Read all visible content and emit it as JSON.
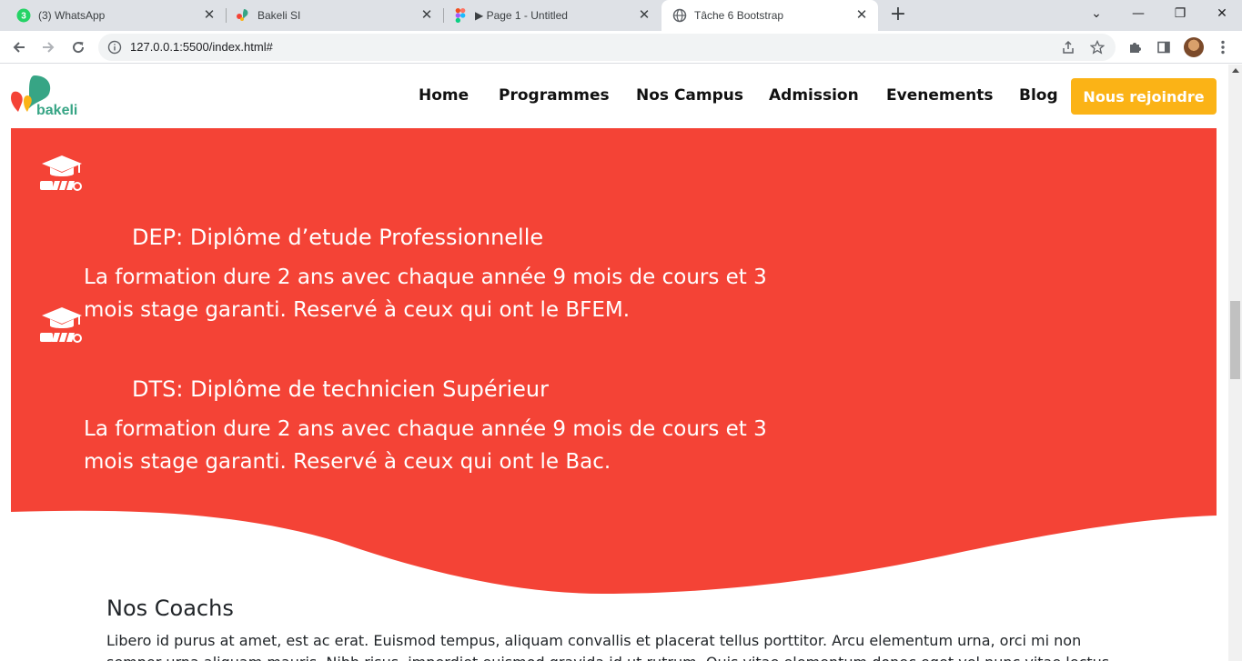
{
  "browser": {
    "tabs": [
      {
        "title": "(3) WhatsApp",
        "badge": "3"
      },
      {
        "title": "Bakeli SI"
      },
      {
        "title": "▶ Page 1 - Untitled"
      },
      {
        "title": "Tâche 6 Bootstrap"
      }
    ],
    "url": "127.0.0.1:5500/index.html#"
  },
  "site": {
    "logo_text": "bakeli",
    "nav": [
      "Home",
      "Programmes",
      "Nos Campus",
      "Admission",
      "Evenements",
      "Blog"
    ],
    "cta_label": "Nous rejoindre",
    "colors": {
      "accent_red": "#f44336",
      "cta_yellow": "#fbb316",
      "logo_green": "#37a585"
    }
  },
  "programs": [
    {
      "title": "DEP: Diplôme d’etude Professionnelle",
      "desc": "La formation dure 2 ans avec chaque année 9 mois de cours et 3 mois stage garanti. Reservé à ceux qui ont le BFEM."
    },
    {
      "title": "DTS: Diplôme de technicien Supérieur",
      "desc": "La formation dure 2 ans avec chaque année 9 mois de cours et 3 mois stage garanti. Reservé à ceux qui ont le Bac."
    }
  ],
  "coachs": {
    "title": "Nos Coachs",
    "text": "Libero id purus at amet, est ac erat. Euismod tempus, aliquam convallis et placerat tellus porttitor. Arcu elementum urna, orci mi non semper urna aliquam mauris. Nibh risus, imperdiet euismod gravida id ut rutrum. Quis vitae elementum donec eget vel nunc vitae lectus."
  }
}
